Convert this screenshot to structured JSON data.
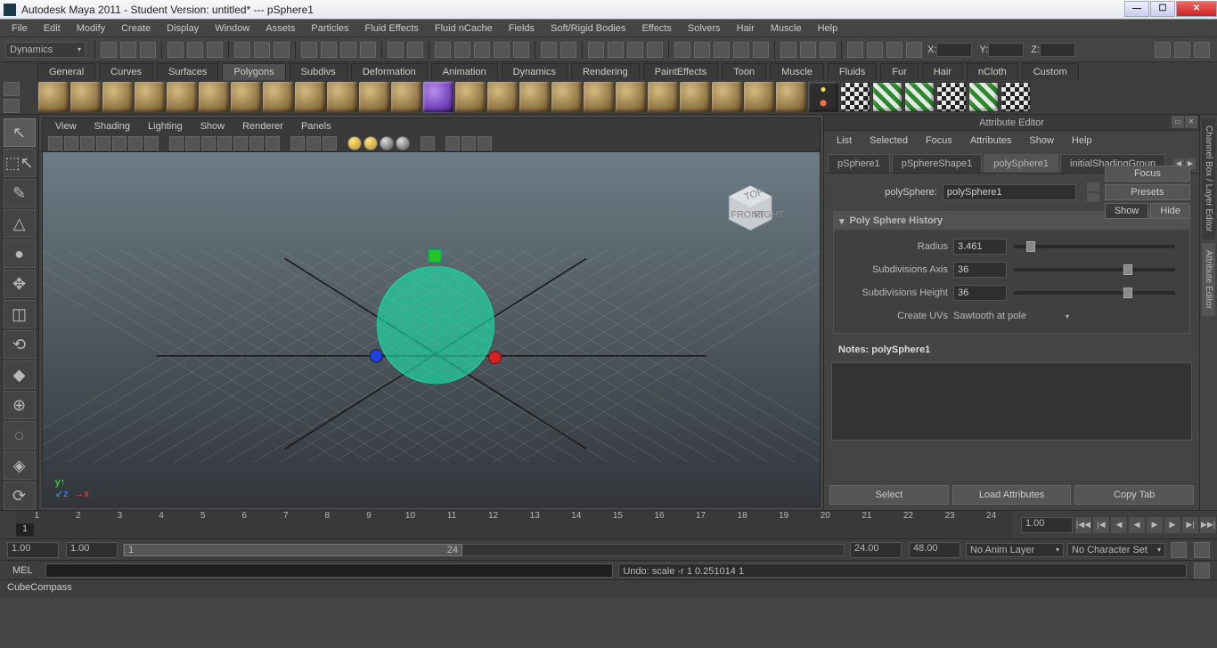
{
  "window": {
    "title": "Autodesk Maya 2011 - Student Version: untitled*  ---  pSphere1"
  },
  "win_ctrl": {
    "min": "—",
    "max": "☐",
    "close": "✕"
  },
  "menu": [
    "File",
    "Edit",
    "Modify",
    "Create",
    "Display",
    "Window",
    "Assets",
    "Particles",
    "Fluid Effects",
    "Fluid nCache",
    "Fields",
    "Soft/Rigid Bodies",
    "Effects",
    "Solvers",
    "Hair",
    "Muscle",
    "Help"
  ],
  "module": "Dynamics",
  "coord": {
    "x": "X:",
    "y": "Y:",
    "z": "Z:"
  },
  "shelf_tabs": [
    "General",
    "Curves",
    "Surfaces",
    "Polygons",
    "Subdivs",
    "Deformation",
    "Animation",
    "Dynamics",
    "Rendering",
    "PaintEffects",
    "Toon",
    "Muscle",
    "Fluids",
    "Fur",
    "Hair",
    "nCloth",
    "Custom"
  ],
  "shelf_active": 3,
  "vp_menu": [
    "View",
    "Shading",
    "Lighting",
    "Show",
    "Renderer",
    "Panels"
  ],
  "attr": {
    "title": "Attribute Editor",
    "menu": [
      "List",
      "Selected",
      "Focus",
      "Attributes",
      "Show",
      "Help"
    ],
    "tabs": [
      "pSphere1",
      "pSphereShape1",
      "polySphere1",
      "initialShadingGroup"
    ],
    "active_tab": 2,
    "focus": "Focus",
    "presets": "Presets",
    "show": "Show",
    "hide": "Hide",
    "node_label": "polySphere:",
    "node_value": "polySphere1",
    "section": "Poly Sphere History",
    "radius_label": "Radius",
    "radius": "3.461",
    "axis_label": "Subdivisions Axis",
    "axis": "36",
    "height_label": "Subdivisions Height",
    "height": "36",
    "uv_label": "Create UVs",
    "uv": "Sawtooth at pole",
    "notes_label": "Notes:  polySphere1",
    "btns": {
      "select": "Select",
      "load": "Load Attributes",
      "copy": "Copy Tab"
    }
  },
  "side_tabs": [
    "Channel Box / Layer Editor",
    "Attribute Editor"
  ],
  "timeline": {
    "ticks": [
      "1",
      "2",
      "3",
      "4",
      "5",
      "6",
      "7",
      "8",
      "9",
      "10",
      "11",
      "12",
      "13",
      "14",
      "15",
      "16",
      "17",
      "18",
      "19",
      "20",
      "21",
      "22",
      "23",
      "24"
    ],
    "current": "1",
    "end": "1.00"
  },
  "range": {
    "start": "1.00",
    "in": "1.00",
    "range_lo": "1",
    "range_hi": "24",
    "out": "24.00",
    "end": "48.00",
    "anim": "No Anim Layer",
    "char": "No Character Set"
  },
  "cmd": {
    "label": "MEL",
    "result": "Undo: scale -r 1 0.251014 1"
  },
  "help": "CubeCompass"
}
